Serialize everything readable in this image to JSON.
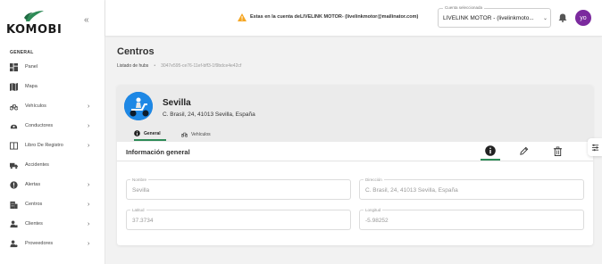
{
  "brand": {
    "logo_text": "KOMOBI",
    "logo_icon": "komobi-leaf-logo"
  },
  "sidebar": {
    "section_label": "GENERAL",
    "items": [
      {
        "label": "Panel",
        "icon": "dashboard-icon",
        "has_chevron": false
      },
      {
        "label": "Mapa",
        "icon": "map-icon",
        "has_chevron": false
      },
      {
        "label": "Vehículos",
        "icon": "bicycle-icon",
        "has_chevron": true
      },
      {
        "label": "Conductores",
        "icon": "drivers-icon",
        "has_chevron": true
      },
      {
        "label": "Libro De Registro",
        "icon": "book-icon",
        "has_chevron": true
      },
      {
        "label": "Accidentes",
        "icon": "truck-icon",
        "has_chevron": false
      },
      {
        "label": "Alertas",
        "icon": "alert-icon",
        "has_chevron": true
      },
      {
        "label": "Centros",
        "icon": "building-icon",
        "has_chevron": true
      },
      {
        "label": "Clientes",
        "icon": "client-icon",
        "has_chevron": true
      },
      {
        "label": "Proveedores",
        "icon": "supplier-icon",
        "has_chevron": true
      }
    ]
  },
  "topbar": {
    "warning_text": "Estas en la cuenta deLIVELINK MOTOR- (livelinkmotor@mailinator.com)",
    "account_select": {
      "legend": "Cuenta seleccionada",
      "value": "LIVELINK MOTOR - (livelinkmoto..."
    },
    "user_avatar": "yo",
    "colors": {
      "warning": "#f5a623",
      "avatar": "#7b2a9e"
    }
  },
  "page": {
    "title": "Centros",
    "breadcrumb": {
      "parent": "Listado de hubs",
      "separator": "•",
      "current": "3047e595-ce76-11ef-bff3-1f9bdce4e42cf"
    }
  },
  "center": {
    "name": "Sevilla",
    "address": "C. Brasil, 24, 41013 Sevilla, España",
    "tabs": [
      {
        "label": "General",
        "icon": "info-icon"
      },
      {
        "label": "Vehículos",
        "icon": "bicycle-icon"
      }
    ],
    "section_title": "Información general",
    "fields": [
      {
        "legend": "Nombre",
        "value": "Sevilla"
      },
      {
        "legend": "Dirección",
        "value": "C. Brasil, 24, 41013 Sevilla, España"
      },
      {
        "legend": "Latitud",
        "value": "37.3734"
      },
      {
        "legend": "Longitud",
        "value": "-5.98252"
      }
    ],
    "accent_color": "#2e8b57"
  }
}
